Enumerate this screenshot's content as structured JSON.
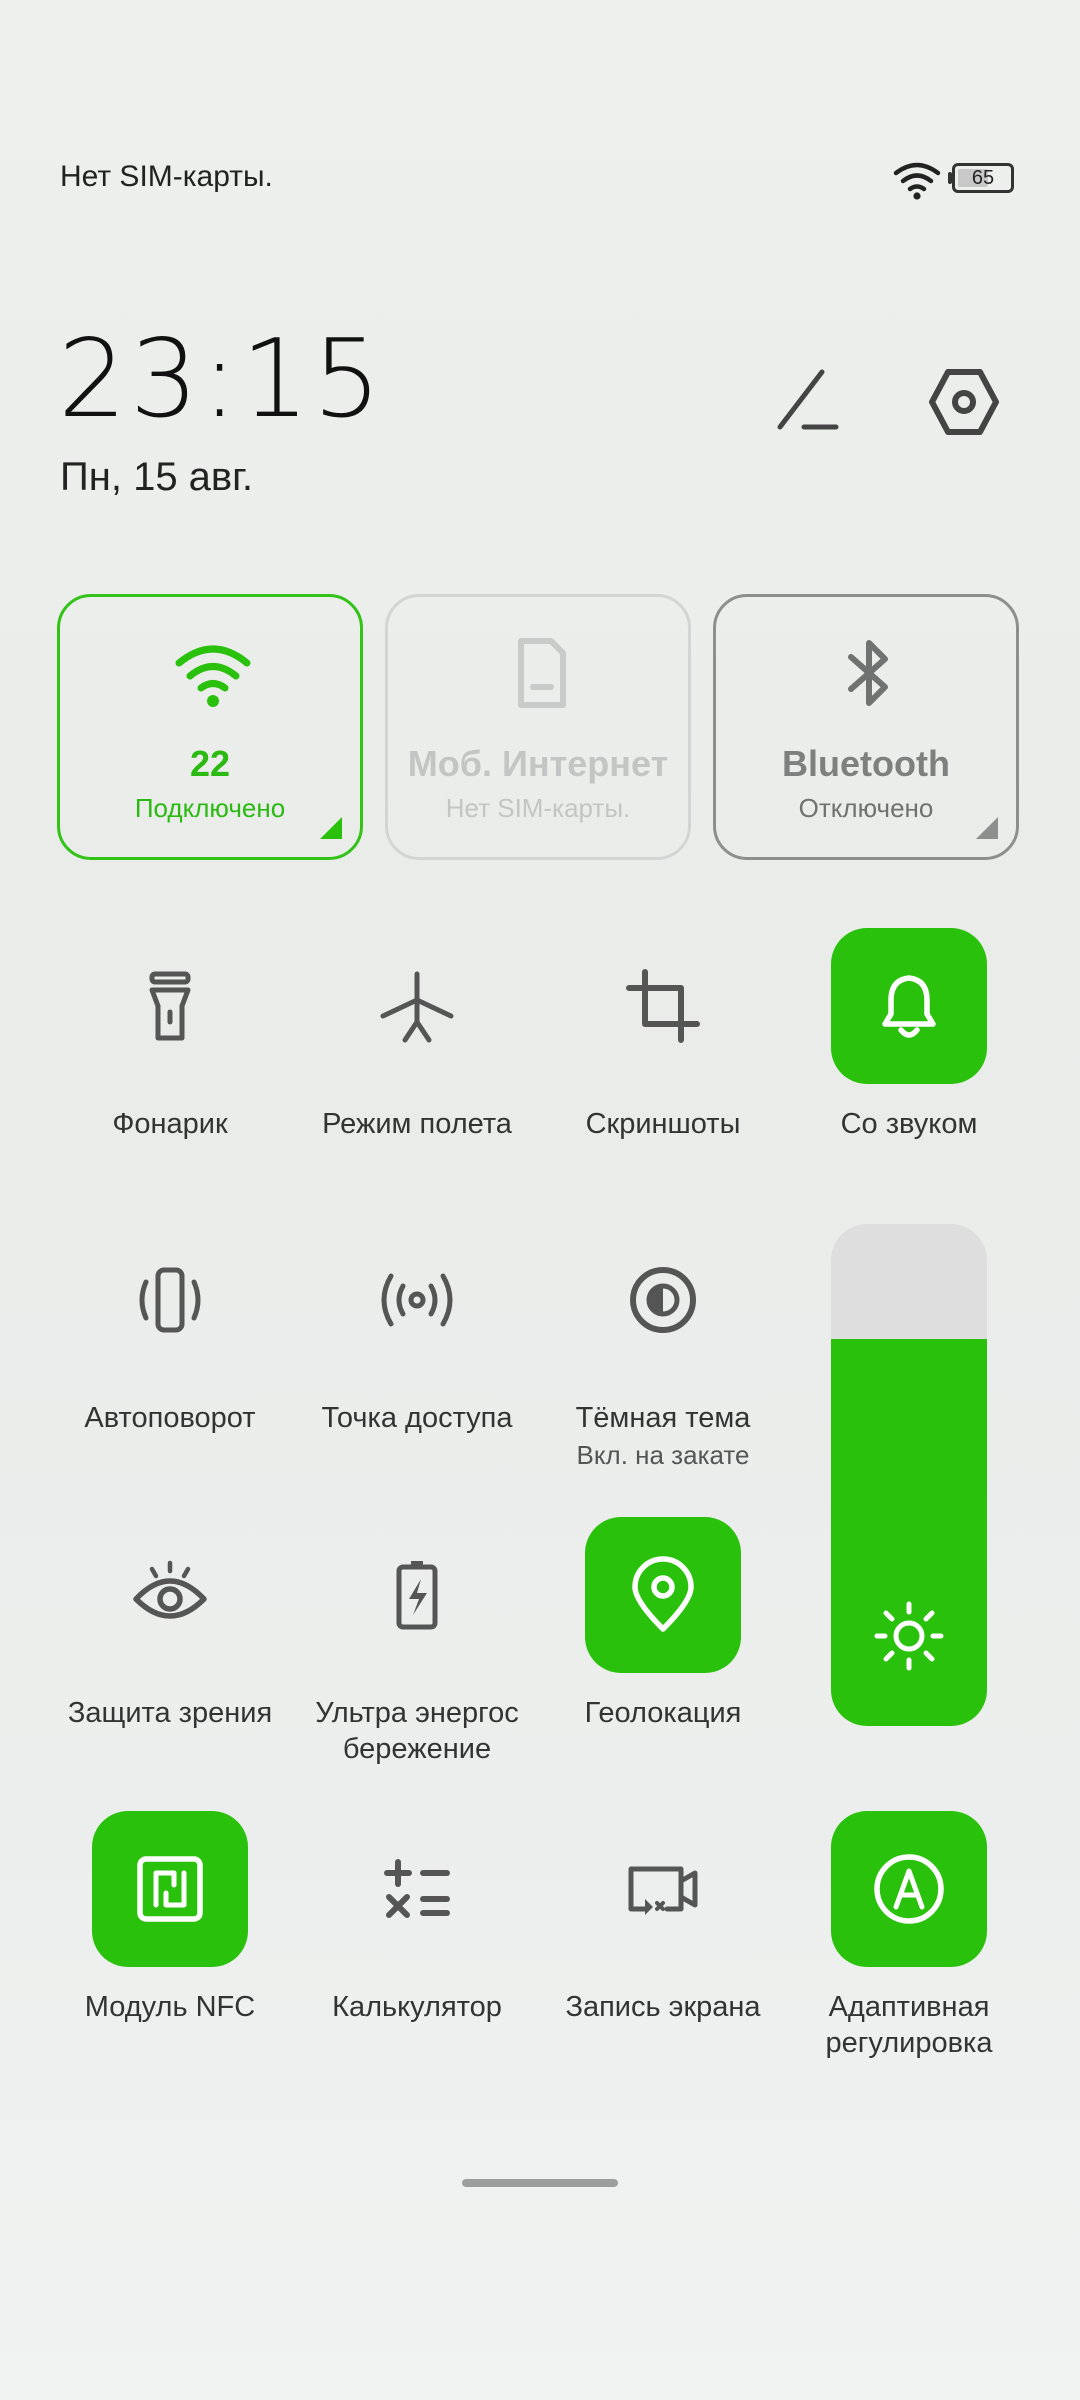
{
  "status_bar": {
    "carrier": "Нет SIM-карты.",
    "battery_level": "65",
    "battery_fraction": 0.65
  },
  "clock": {
    "time": "23:15",
    "date": "Пн, 15 авг."
  },
  "header_icons": [
    "edit-icon",
    "settings-icon"
  ],
  "big_tiles": {
    "wifi": {
      "title": "22",
      "subtitle": "Подключено",
      "icon": "wifi-icon"
    },
    "mobile": {
      "title": "Моб. Интернет",
      "subtitle": "Нет SIM-карты.",
      "icon": "sim-card-icon"
    },
    "bluetooth": {
      "title": "Bluetooth",
      "subtitle": "Отключено",
      "icon": "bluetooth-icon"
    }
  },
  "toggles": {
    "flashlight": {
      "label": "Фонарик",
      "icon": "flashlight-icon",
      "active": false
    },
    "airplane": {
      "label": "Режим полета",
      "icon": "airplane-icon",
      "active": false
    },
    "screenshot": {
      "label": "Скриншоты",
      "icon": "crop-icon",
      "active": false
    },
    "sound": {
      "label": "Со звуком",
      "icon": "bell-icon",
      "active": true
    },
    "autorotate": {
      "label": "Автоповорот",
      "icon": "rotate-phone-icon",
      "active": false
    },
    "hotspot": {
      "label": "Точка доступа",
      "icon": "hotspot-icon",
      "active": false
    },
    "dark_theme": {
      "label": "Тёмная тема",
      "sublabel": "Вкл. на закате",
      "icon": "dark-mode-icon",
      "active": false
    },
    "eye_protection": {
      "label": "Защита зрения",
      "icon": "eye-icon",
      "active": false
    },
    "power_saving": {
      "label": "Ультра энергос бережение",
      "icon": "battery-bolt-icon",
      "active": false
    },
    "location": {
      "label": "Геолокация",
      "icon": "location-pin-icon",
      "active": true
    },
    "nfc": {
      "label": "Модуль NFC",
      "icon": "nfc-icon",
      "active": true
    },
    "calculator": {
      "label": "Калькулятор",
      "icon": "calculator-icon",
      "active": false
    },
    "screen_record": {
      "label": "Запись экрана",
      "icon": "screen-record-icon",
      "active": false
    },
    "adaptive_brightness": {
      "label": "Адаптивная регулировка",
      "icon": "auto-brightness-icon",
      "active": true
    }
  },
  "brightness": {
    "level": 0.77,
    "icon": "sun-icon"
  },
  "colors": {
    "accent": "#2ac10c",
    "accent_text": "#2bba12",
    "icon": "#555555",
    "slider_track": "#dedede"
  }
}
